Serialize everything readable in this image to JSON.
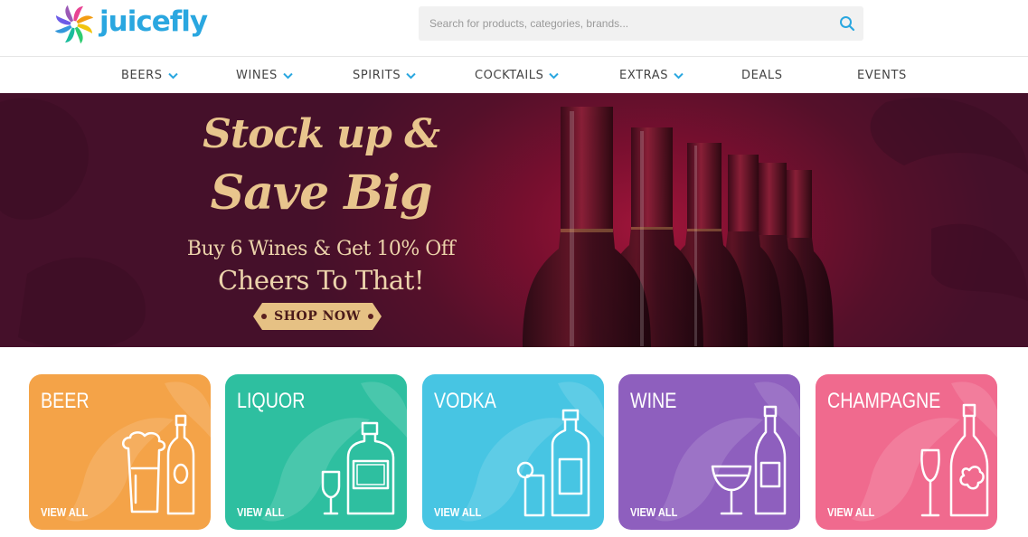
{
  "brand": {
    "name": "juicefly",
    "colors": {
      "primary": "#2aa7e0"
    }
  },
  "search": {
    "placeholder": "Search for products, categories, brands...",
    "value": "",
    "icon": "search-icon"
  },
  "nav": {
    "items": [
      {
        "label": "BEERS",
        "has_dropdown": true
      },
      {
        "label": "WINES",
        "has_dropdown": true
      },
      {
        "label": "SPIRITS",
        "has_dropdown": true
      },
      {
        "label": "COCKTAILS",
        "has_dropdown": true
      },
      {
        "label": "EXTRAS",
        "has_dropdown": true
      },
      {
        "label": "DEALS",
        "has_dropdown": false
      },
      {
        "label": "EVENTS",
        "has_dropdown": false
      }
    ]
  },
  "hero": {
    "title_line1": "Stock up &",
    "title_line2": "Save Big",
    "subtitle": "Buy 6 Wines & Get 10% Off",
    "tagline": "Cheers To That!",
    "cta": "SHOP NOW",
    "colors": {
      "background": "#6a0f2e",
      "text_gold": "#e8c58d"
    }
  },
  "categories": [
    {
      "title": "BEER",
      "link": "VIEW ALL",
      "color": "#f4a348",
      "icon": "beer-icon"
    },
    {
      "title": "LIQUOR",
      "link": "VIEW ALL",
      "color": "#2ebfa0",
      "icon": "liquor-icon"
    },
    {
      "title": "VODKA",
      "link": "VIEW ALL",
      "color": "#47c5e3",
      "icon": "vodka-icon"
    },
    {
      "title": "WINE",
      "link": "VIEW ALL",
      "color": "#8e5fbe",
      "icon": "wine-icon"
    },
    {
      "title": "CHAMPAGNE",
      "link": "VIEW ALL",
      "color": "#f06a8e",
      "icon": "champagne-icon"
    }
  ]
}
